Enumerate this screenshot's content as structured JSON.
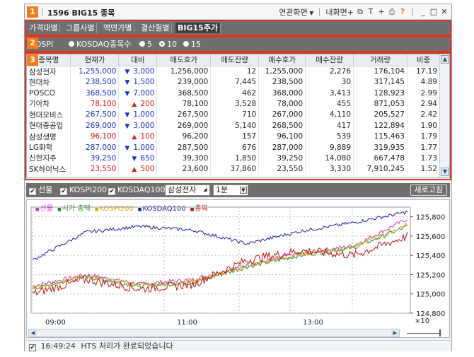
{
  "window": {
    "title": "1596 BIG15 종목",
    "toolbar": {
      "related_screen": "연관화면",
      "my_screen": "내화면",
      "help": "?"
    }
  },
  "badges": [
    "1",
    "2",
    "3"
  ],
  "tabs": [
    "가격대별",
    "그룹사별",
    "액면가별",
    "결산월별",
    "BIG15주가"
  ],
  "options": {
    "kospi": "KOSPI",
    "kosdaq": "KOSDAQ",
    "count_label": "종목수",
    "count_options": [
      "5",
      "10",
      "15"
    ],
    "count_selected": "10"
  },
  "table": {
    "columns": [
      "종목명",
      "현재가",
      "대비",
      "매도호가",
      "매도잔량",
      "매수호가",
      "매수잔량",
      "거래량",
      "비중"
    ],
    "rows": [
      {
        "name": "삼성전자",
        "price": "1,255,000",
        "dir": "down",
        "change": "3,000",
        "ask": "1,256,000",
        "ask_vol": "12",
        "bid": "1,255,000",
        "bid_vol": "2,276",
        "volume": "176,104",
        "weight": "17.19"
      },
      {
        "name": "현대차",
        "price": "238,500",
        "dir": "down",
        "change": "1,500",
        "ask": "239,000",
        "ask_vol": "7,445",
        "bid": "238,500",
        "bid_vol": "30",
        "volume": "317,145",
        "weight": "4.89"
      },
      {
        "name": "POSCO",
        "price": "368,500",
        "dir": "down",
        "change": "7,000",
        "ask": "368,500",
        "ask_vol": "462",
        "bid": "368,000",
        "bid_vol": "3,413",
        "volume": "128,923",
        "weight": "2.99"
      },
      {
        "name": "기아차",
        "price": "78,100",
        "dir": "up",
        "change": "200",
        "ask": "78,100",
        "ask_vol": "3,528",
        "bid": "78,000",
        "bid_vol": "455",
        "volume": "871,053",
        "weight": "2.94"
      },
      {
        "name": "현대모비스",
        "price": "267,500",
        "dir": "down",
        "change": "1,000",
        "ask": "267,500",
        "ask_vol": "710",
        "bid": "267,000",
        "bid_vol": "4,110",
        "volume": "205,527",
        "weight": "2.42"
      },
      {
        "name": "현대중공업",
        "price": "269,000",
        "dir": "down",
        "change": "3,000",
        "ask": "269,000",
        "ask_vol": "5,140",
        "bid": "268,500",
        "bid_vol": "417",
        "volume": "122,894",
        "weight": "1.90"
      },
      {
        "name": "삼성생명",
        "price": "96,100",
        "dir": "up",
        "change": "100",
        "ask": "96,200",
        "ask_vol": "157",
        "bid": "96,100",
        "bid_vol": "539",
        "volume": "115,463",
        "weight": "1.79"
      },
      {
        "name": "LG화학",
        "price": "287,000",
        "dir": "down",
        "change": "1,000",
        "ask": "287,500",
        "ask_vol": "676",
        "bid": "287,000",
        "bid_vol": "9,889",
        "volume": "319,935",
        "weight": "1.77"
      },
      {
        "name": "신한지주",
        "price": "39,250",
        "dir": "down",
        "change": "650",
        "ask": "39,300",
        "ask_vol": "1,850",
        "bid": "39,250",
        "bid_vol": "14,080",
        "volume": "667,478",
        "weight": "1.73"
      },
      {
        "name": "SK하이닉스",
        "price": "23,550",
        "dir": "up",
        "change": "500",
        "ask": "23,600",
        "ask_vol": "37,860",
        "bid": "23,550",
        "bid_vol": "3,330",
        "volume": "7,910,245",
        "weight": "1.52"
      }
    ]
  },
  "controls": {
    "futures": "선물",
    "kospi200": "KOSPI200",
    "kosdaq100": "KOSDAQ100",
    "stock_select": "삼성전자",
    "interval": "1분",
    "refresh": "새로고침"
  },
  "chart": {
    "legend": [
      {
        "label": "선물",
        "color": "#c73bd1"
      },
      {
        "label": "시가 총액",
        "color": "#2f8a2f"
      },
      {
        "label": "KOSPI200",
        "color": "#d4a21a"
      },
      {
        "label": "KOSDAQ100",
        "color": "#1c1c9e"
      },
      {
        "label": "종목",
        "color": "#c01616"
      }
    ],
    "y_ticks": [
      "125,800",
      "125,600",
      "125,400",
      "125,200",
      "125,000",
      "124,800"
    ],
    "y_multiplier": "×10",
    "x_ticks": [
      "09:00",
      "11:00",
      "13:00"
    ]
  },
  "chart_data": {
    "type": "line",
    "x": [
      "09:00",
      "11:00",
      "13:00"
    ],
    "ylim": [
      124800,
      125900
    ],
    "series": [
      {
        "name": "선물",
        "values": [
          125080,
          125200,
          125100,
          125150,
          125300,
          125420,
          125500,
          125780
        ]
      },
      {
        "name": "시가 총액",
        "values": [
          125050,
          125180,
          125080,
          125120,
          125280,
          125400,
          125480,
          125700
        ]
      },
      {
        "name": "KOSPI200",
        "values": [
          125060,
          125190,
          125090,
          125130,
          125290,
          125410,
          125490,
          125720
        ]
      },
      {
        "name": "KOSDAQ100",
        "values": [
          125350,
          125640,
          125700,
          125660,
          125520,
          125650,
          125740,
          125850
        ]
      },
      {
        "name": "종목",
        "values": [
          125000,
          125150,
          125050,
          125100,
          125350,
          125450,
          125400,
          125600
        ]
      }
    ]
  },
  "status": {
    "time": "16:49:24",
    "message": "HTS 처리가 완료되었습니다"
  }
}
